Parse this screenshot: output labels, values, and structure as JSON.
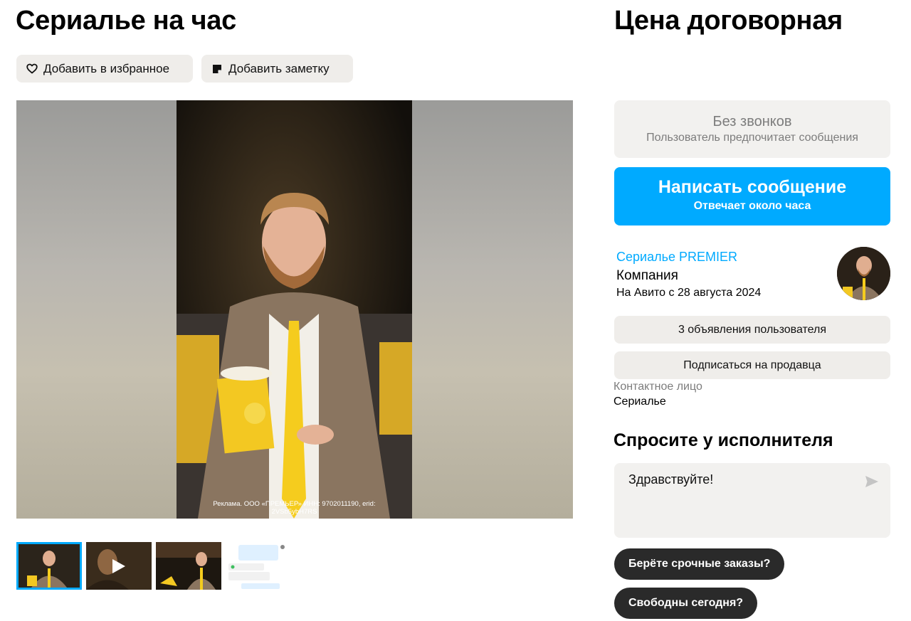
{
  "listing": {
    "title": "Сериалье на час",
    "price": "Цена договорная"
  },
  "actions": {
    "favorite_label": "Добавить в избранное",
    "note_label": "Добавить заметку"
  },
  "gallery": {
    "ad_caption": "Реклама. ООО «ПРЕМЬЕР» ИНН: 9702011190, erid: 2VSb5ybH7RS",
    "thumbnails": [
      "photo",
      "video",
      "photo",
      "chat-screenshot"
    ],
    "active_thumbnail": 1
  },
  "contact": {
    "no_calls_title": "Без звонков",
    "no_calls_subtitle": "Пользователь предпочитает сообщения",
    "message_button": "Написать сообщение",
    "message_subtitle": "Отвечает около часа"
  },
  "seller": {
    "name": "Сериалье PREMIER",
    "type": "Компания",
    "since": "На Авито с 28 августа 2024",
    "listings_button": "3 объявления пользователя",
    "subscribe_button": "Подписаться на продавца",
    "contact_person_label": "Контактное лицо",
    "contact_person_name": "Сериалье"
  },
  "ask": {
    "title": "Спросите у исполнителя",
    "message_value": "Здравствуйте!",
    "quick_replies": [
      "Берёте срочные заказы?",
      "Свободны сегодня?"
    ]
  },
  "colors": {
    "accent": "#00aaff",
    "chip_bg": "#2a2a2a",
    "button_bg": "#efedea"
  }
}
